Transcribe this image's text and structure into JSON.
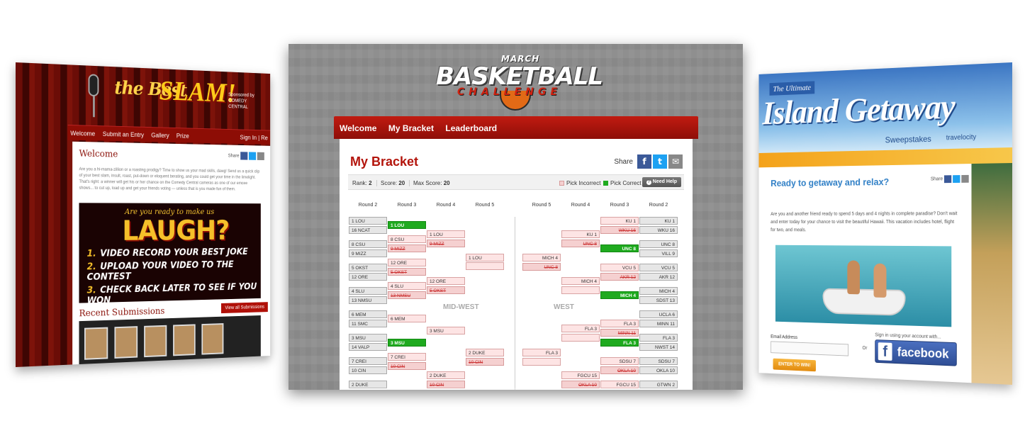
{
  "left": {
    "the_best": "the Best",
    "slam": "SLAM!",
    "sponsor": "Sponsored by COMEDY CENTRAL",
    "nav": [
      "Welcome",
      "Submit an Entry",
      "Gallery",
      "Prize"
    ],
    "signin": "Sign In | Re",
    "welcome": "Welcome",
    "share": "Share",
    "intro": "Are you a hi-mama-zillion or a roasting prodigy? Time to show us your mad skills, dawg! Send us a quick clip of your best slam, insult, roast, put-down or eloquent berating, and you could get your time in the limelight. That's right: a winner will get his or her chance on the Comedy Central cameras as one of our emcee shows... to cut up, load up and get your friends voting — unless that is you made fun of them.",
    "question": "Are you ready to make us",
    "laugh": "LAUGH?",
    "steps": [
      "VIDEO RECORD YOUR BEST JOKE",
      "UPLOAD YOUR VIDEO TO THE CONTEST",
      "CHECK BACK LATER TO SEE IF YOU WON"
    ],
    "recent": "Recent Submissions",
    "view_all": "View all Submissions"
  },
  "center": {
    "logo": {
      "march": "MARCH",
      "main": "BASKETBALL",
      "sub": "CHALLENGE"
    },
    "nav": [
      "Welcome",
      "My Bracket",
      "Leaderboard"
    ],
    "title": "My Bracket",
    "share": "Share",
    "stats": {
      "rank_label": "Rank:",
      "rank": "2",
      "score_label": "Score:",
      "score": "20",
      "max_label": "Max Score:",
      "max": "20"
    },
    "legend": {
      "incorrect": "Pick Incorrect",
      "correct": "Pick Correct"
    },
    "help": "Need Help",
    "rounds": [
      "Round 2",
      "Round 3",
      "Round 4",
      "Round 5",
      "Round 5",
      "Round 4",
      "Round 3",
      "Round 2"
    ],
    "regions": [
      "MID-WEST",
      "WEST"
    ],
    "colors": {
      "correct": "#1faa1f",
      "incorrect": "#f5d0d0",
      "accent": "#b3140b"
    },
    "left_r2": [
      "1 LOU",
      "16 NCAT",
      "8 CSU",
      "9 MIZZ",
      "5 OKST",
      "12 ORE",
      "4 SLU",
      "13 NMSU",
      "6 MEM",
      "11 SMC",
      "3 MSU",
      "14 VALP",
      "7 CREI",
      "10 CIN",
      "2 DUKE"
    ],
    "left_r3": [
      "1 LOU",
      "8 CSU",
      "9 MIZZ",
      "12 ORE",
      "5 OKST",
      "4 SLU",
      "13 NMSU",
      "6 MEM",
      "3 MSU",
      "7 CREI",
      "10 CIN"
    ],
    "left_r4": [
      "1 LOU",
      "9 MIZZ",
      "12 ORE",
      "5 OKST",
      "3 MSU",
      "2 DUKE",
      "10 CIN"
    ],
    "left_r5": [
      "1 LOU",
      "2 DUKE",
      "10 CIN"
    ],
    "right_r2": [
      "KU 1",
      "WKU 16",
      "UNC 8",
      "VILL 9",
      "VCU 5",
      "AKR 12",
      "MICH 4",
      "SDST 13",
      "UCLA 6",
      "MINN 11",
      "FLA 3",
      "NWST 14",
      "SDSU 7",
      "OKLA 10",
      "GTWN 2"
    ],
    "right_r3": [
      "KU 1",
      "WKU 16",
      "UNC 8",
      "VCU 5",
      "AKR 12",
      "MICH 4",
      "FLA 3",
      "MINN 11",
      "FLA 3",
      "SDSU 7",
      "OKLA 10",
      "FGCU 15"
    ],
    "right_r4": [
      "KU 1",
      "UNC 8",
      "MICH 4",
      "FLA 3",
      "FGCU 15",
      "OKLA 10"
    ],
    "right_r5": [
      "MICH 4",
      "UNC 8",
      "FLA 3"
    ]
  },
  "right": {
    "ultimate": "The Ultimate",
    "island": "Island Getaway",
    "sweepstakes": "Sweepstakes",
    "brand": "travelocity",
    "heading": "Ready to getaway and relax?",
    "share": "Share",
    "text": "Are you and another friend ready to spend 5 days and 4 nights in complete paradise? Don't wait and enter today for your chance to visit the beautiful Hawaii. This vacation includes hotel, flight for two, and meals.",
    "email_label": "Email Address",
    "or": "Or",
    "signin": "Sign in using your account with...",
    "facebook": "facebook",
    "enter": "ENTER TO WIN!"
  }
}
